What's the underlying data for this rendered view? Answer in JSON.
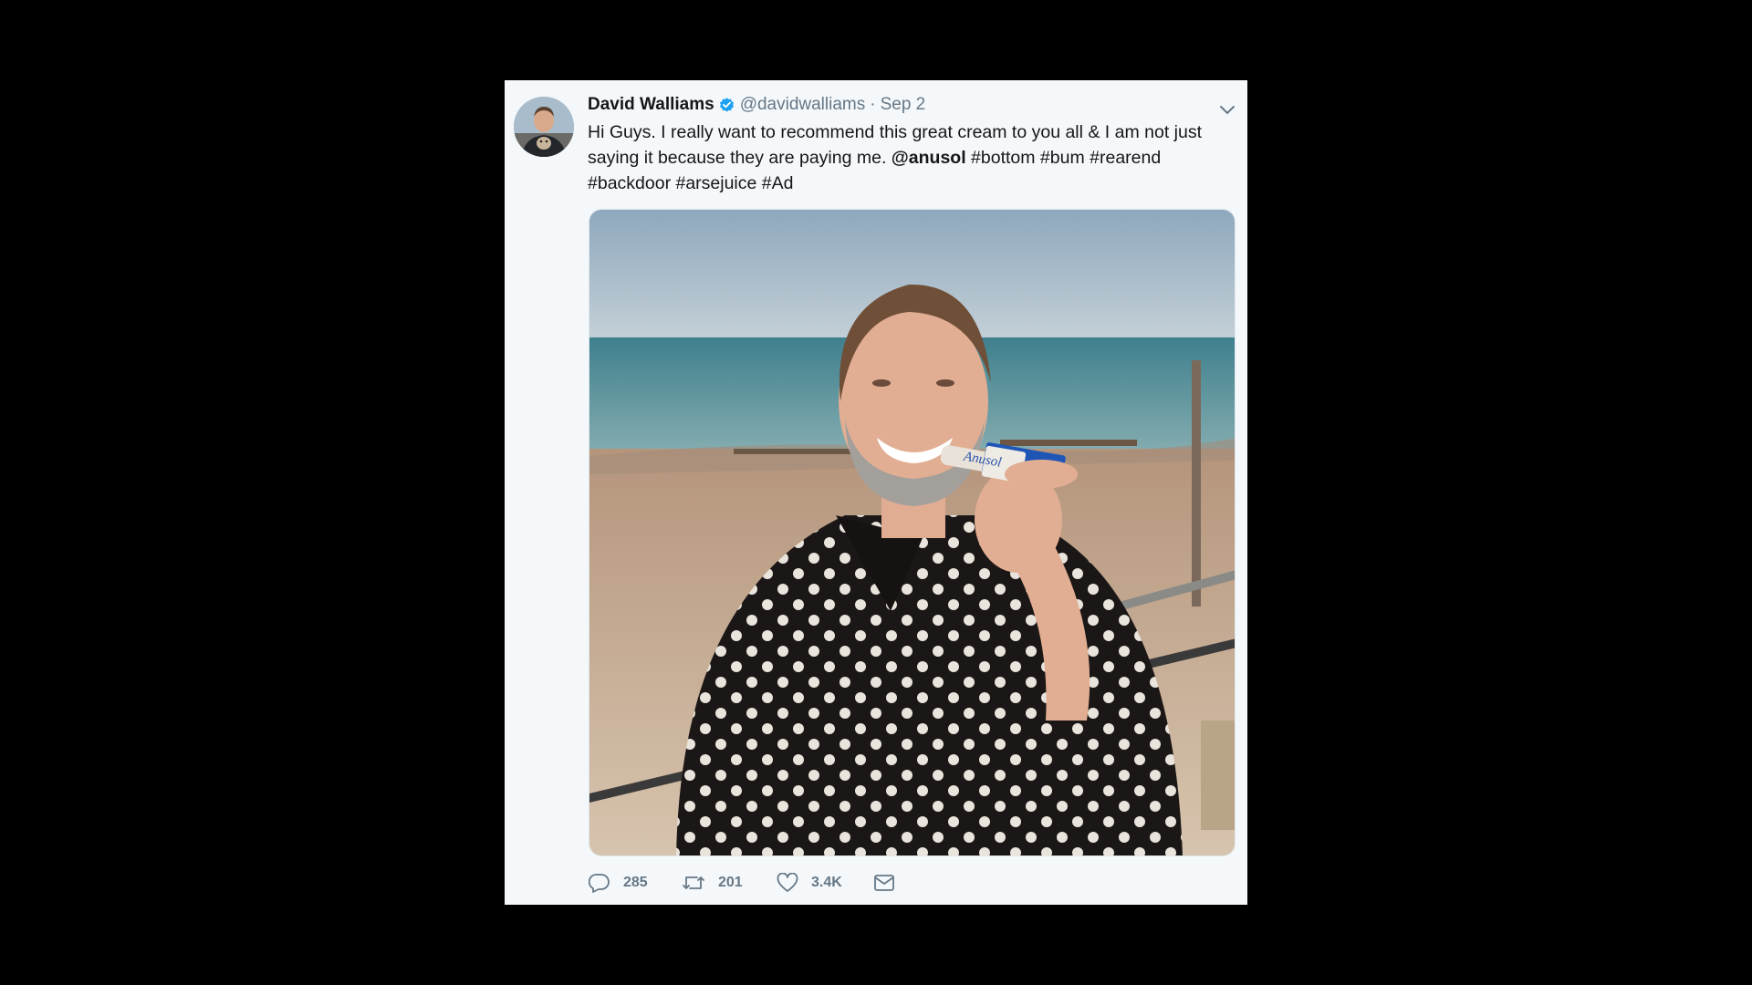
{
  "tweet": {
    "author": {
      "display_name": "David Walliams",
      "verified": true,
      "handle": "@davidwalliams"
    },
    "separator": "·",
    "date": "Sep 2",
    "text": {
      "part1": "Hi Guys. I really want to recommend this great cream to you all & I am not just saying it because they are paying me. ",
      "mention": "@anusol",
      "part2": " #bottom #bum #rearend #backdoor #arsejuice #Ad"
    },
    "media": {
      "product_label": "Anusol"
    },
    "actions": {
      "reply": {
        "icon": "reply-icon",
        "count": "285"
      },
      "retweet": {
        "icon": "retweet-icon",
        "count": "201"
      },
      "like": {
        "icon": "heart-icon",
        "count": "3.4K"
      },
      "message": {
        "icon": "envelope-icon"
      }
    }
  },
  "colors": {
    "background": "#000000",
    "card": "#f5f8fa",
    "text": "#14171a",
    "muted": "#657786",
    "verified": "#1da1f2"
  }
}
